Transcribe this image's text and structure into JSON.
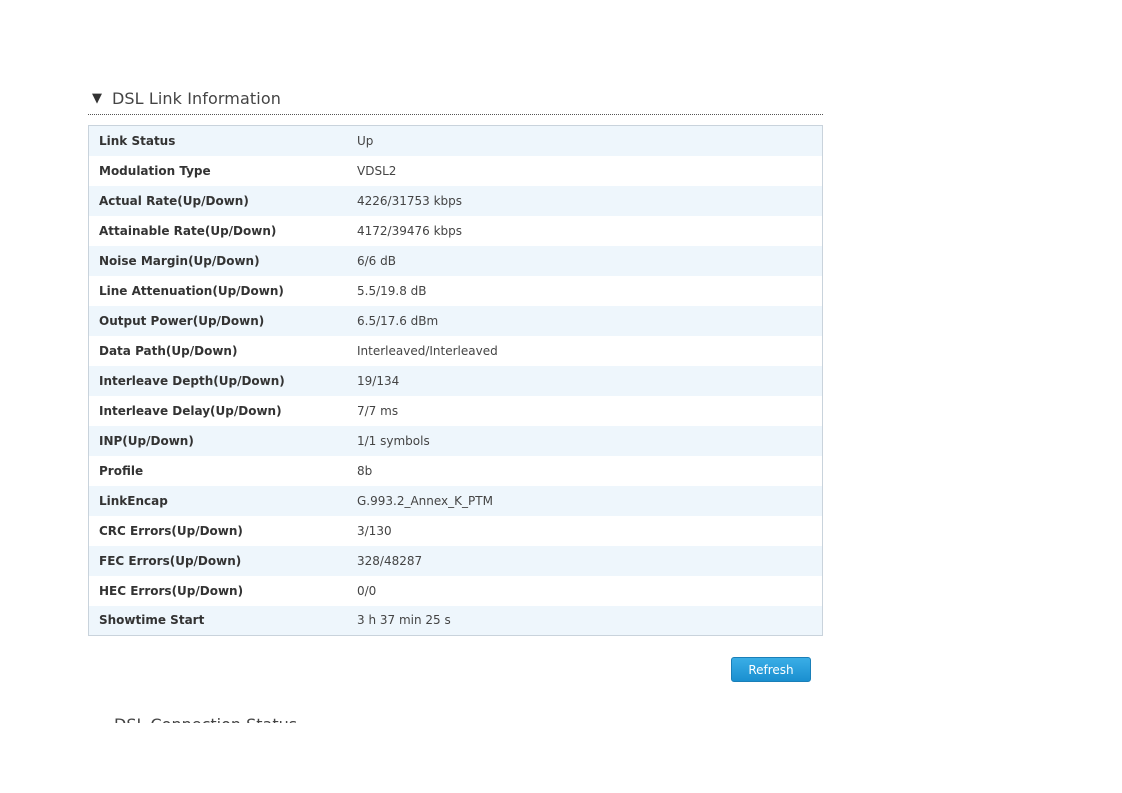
{
  "section": {
    "toggle_glyph": "▼",
    "title": "DSL Link Information"
  },
  "rows": [
    {
      "label": "Link Status",
      "value": "Up"
    },
    {
      "label": "Modulation Type",
      "value": "VDSL2"
    },
    {
      "label": "Actual Rate(Up/Down)",
      "value": "4226/31753 kbps"
    },
    {
      "label": "Attainable Rate(Up/Down)",
      "value": "4172/39476 kbps"
    },
    {
      "label": "Noise Margin(Up/Down)",
      "value": "6/6 dB"
    },
    {
      "label": "Line Attenuation(Up/Down)",
      "value": "5.5/19.8 dB"
    },
    {
      "label": "Output Power(Up/Down)",
      "value": "6.5/17.6 dBm"
    },
    {
      "label": "Data Path(Up/Down)",
      "value": "Interleaved/Interleaved"
    },
    {
      "label": "Interleave Depth(Up/Down)",
      "value": "19/134"
    },
    {
      "label": "Interleave Delay(Up/Down)",
      "value": "7/7 ms"
    },
    {
      "label": "INP(Up/Down)",
      "value": "1/1 symbols"
    },
    {
      "label": "Profile",
      "value": "8b"
    },
    {
      "label": "LinkEncap",
      "value": "G.993.2_Annex_K_PTM"
    },
    {
      "label": "CRC Errors(Up/Down)",
      "value": "3/130"
    },
    {
      "label": "FEC Errors(Up/Down)",
      "value": "328/48287"
    },
    {
      "label": "HEC Errors(Up/Down)",
      "value": "0/0"
    },
    {
      "label": "Showtime Start",
      "value": "3 h 37 min 25 s"
    }
  ],
  "refresh_label": "Refresh",
  "next_section": {
    "title": "DSL Connection Status"
  }
}
